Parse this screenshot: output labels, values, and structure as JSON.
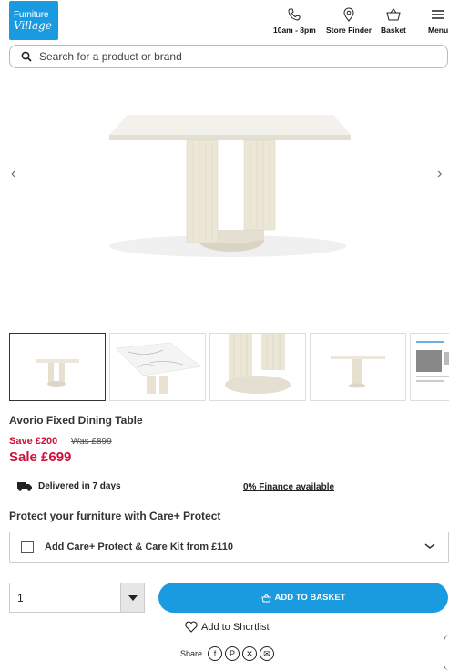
{
  "header": {
    "logo_line1": "Furniture",
    "logo_line2": "Village",
    "nav": [
      {
        "label": "10am - 8pm",
        "icon": "phone-icon"
      },
      {
        "label": "Store Finder",
        "icon": "location-pin-icon"
      },
      {
        "label": "Basket",
        "icon": "basket-icon"
      },
      {
        "label": "Menu",
        "icon": "hamburger-icon"
      }
    ]
  },
  "search": {
    "placeholder": "Search for a product or brand"
  },
  "product": {
    "title": "Avorio Fixed Dining Table",
    "save": "Save £200",
    "was": "Was £899",
    "sale": "Sale £699"
  },
  "info": {
    "delivery": "Delivered in 7 days",
    "finance": "0% Finance available"
  },
  "protect": {
    "heading": "Protect your furniture with Care+ Protect",
    "option": "Add Care+ Protect & Care Kit from £110"
  },
  "purchase": {
    "quantity": "1",
    "add_to_basket": "ADD TO BASKET",
    "shortlist": "Add to Shortlist",
    "share_label": "Share"
  },
  "colors": {
    "brand": "#1a9be0",
    "sale": "#d0103a"
  }
}
